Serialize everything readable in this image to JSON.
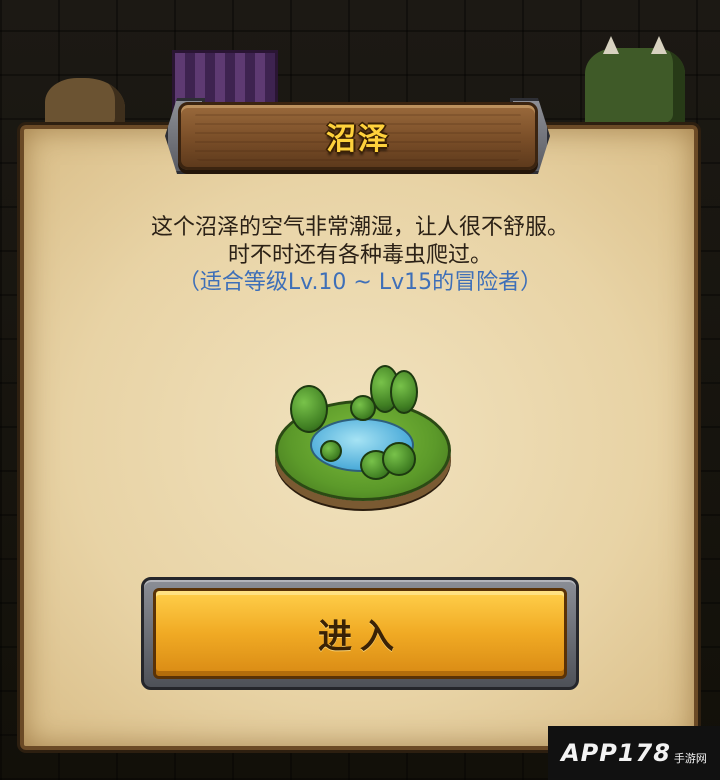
{
  "dialog": {
    "title": "沼泽",
    "description_line1": "这个沼泽的空气非常潮湿，让人很不舒服。",
    "description_line2": "时不时还有各种毒虫爬过。",
    "level_requirement": "（适合等级Lv.10 ~ Lv15的冒险者）",
    "illustration": "swamp-island-icon",
    "enter_button_label": "进入"
  },
  "watermark": {
    "brand": "APP178",
    "sub": "手游网"
  },
  "colors": {
    "title_text": "#ffd23c",
    "level_text": "#3e6fb8",
    "button": "#f0aa24",
    "parchment": "#ead6a8"
  }
}
